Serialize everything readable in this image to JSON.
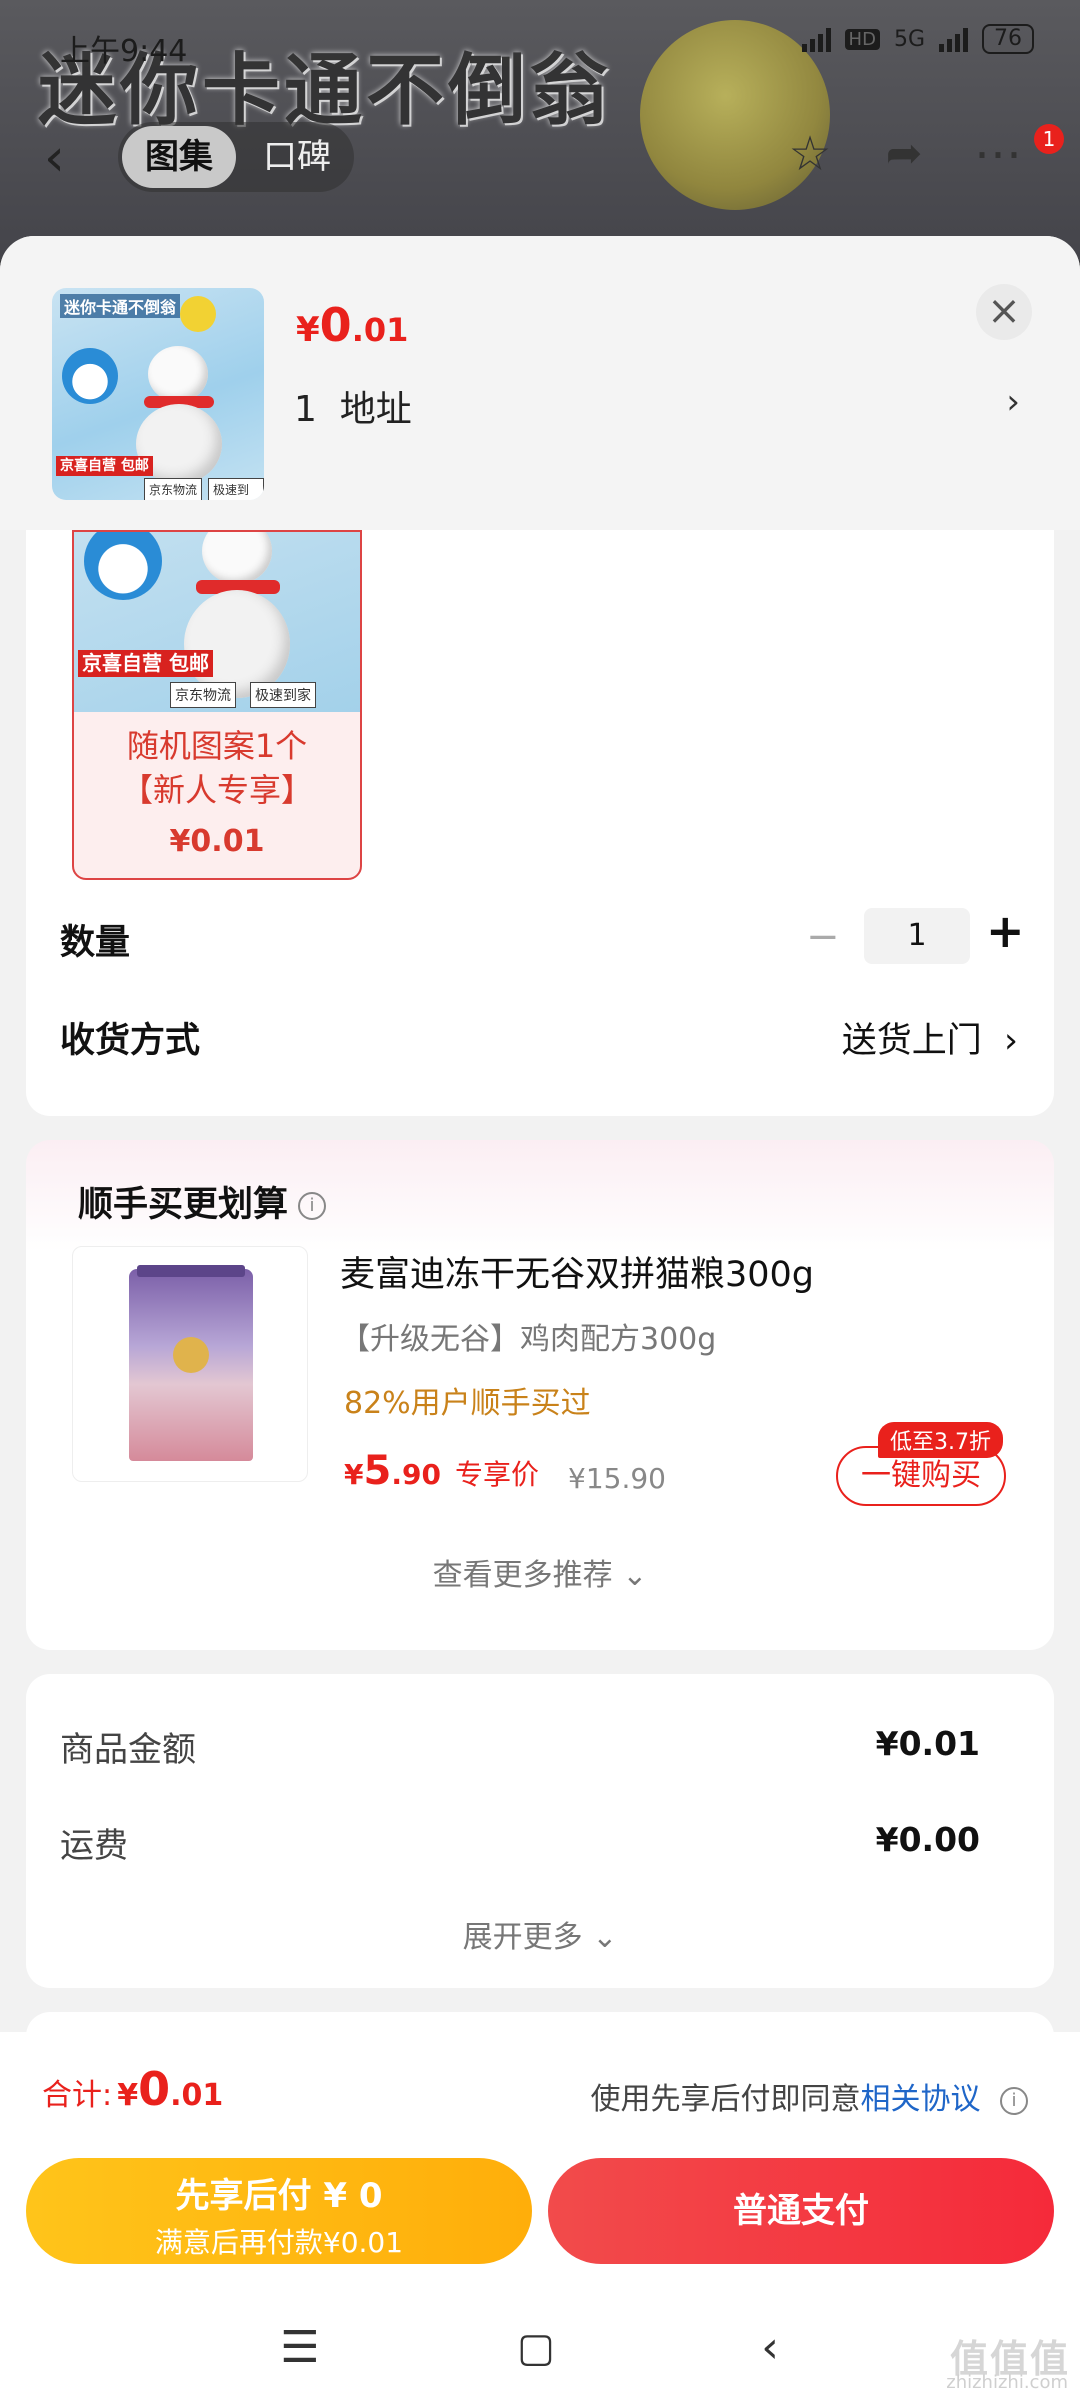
{
  "background": {
    "banner_text": "迷你卡通不倒翁",
    "status_time": "上午9:44",
    "status_network": "5G",
    "status_hd": "HD",
    "battery": "76",
    "tabs": [
      "图集",
      "口碑"
    ],
    "notification_count": "1"
  },
  "header": {
    "price_currency": "¥",
    "price_integer": "0",
    "price_decimal": ".01",
    "address_index": "1",
    "address_label": "地址",
    "thumb_title": "迷你卡通不倒翁",
    "thumb_tag": "京喜自营 包邮",
    "thumb_tag_logistics": "京东物流",
    "thumb_tag_fast": "极速到家"
  },
  "variant": {
    "name_line1": "随机图案1个",
    "name_line2": "【新人专享】",
    "price": "¥0.01",
    "tag": "京喜自营 包邮",
    "tag_logistics": "京东物流",
    "tag_fast": "极速到家"
  },
  "quantity": {
    "label": "数量",
    "value": "1",
    "minus": "−",
    "plus": "+"
  },
  "shipping": {
    "label": "收货方式",
    "value": "送货上门"
  },
  "recommend": {
    "title": "顺手买更划算",
    "product_name": "麦富迪冻干无谷双拼猫粮300g",
    "product_spec": "【升级无谷】鸡肉配方300g",
    "product_stat": "82%用户顺手买过",
    "price_currency": "¥",
    "price_integer": "5",
    "price_decimal": ".90",
    "price_label": "专享价",
    "original_price": "¥15.90",
    "discount_tag": "低至3.7折",
    "buy_button": "一键购买",
    "more_link": "查看更多推荐"
  },
  "summary": {
    "goods_label": "商品金额",
    "goods_value": "¥0.01",
    "freight_label": "运费",
    "freight_value": "¥0.00",
    "expand_link": "展开更多"
  },
  "footer": {
    "total_label": "合计:",
    "total_currency": "¥",
    "total_integer": "0",
    "total_decimal": ".01",
    "agree_text": "使用先享后付即同意",
    "agree_link": "相关协议",
    "later_pay_line1": "先享后付 ¥ 0",
    "later_pay_line2": "满意后再付款¥0.01",
    "normal_pay": "普通支付"
  },
  "watermark": {
    "text": "值值值",
    "sub": "zhizhizhi.com"
  },
  "colors": {
    "accent_red": "#e9211c",
    "later_pay_yellow": "#ffb814",
    "link_blue": "#1f66c8"
  }
}
